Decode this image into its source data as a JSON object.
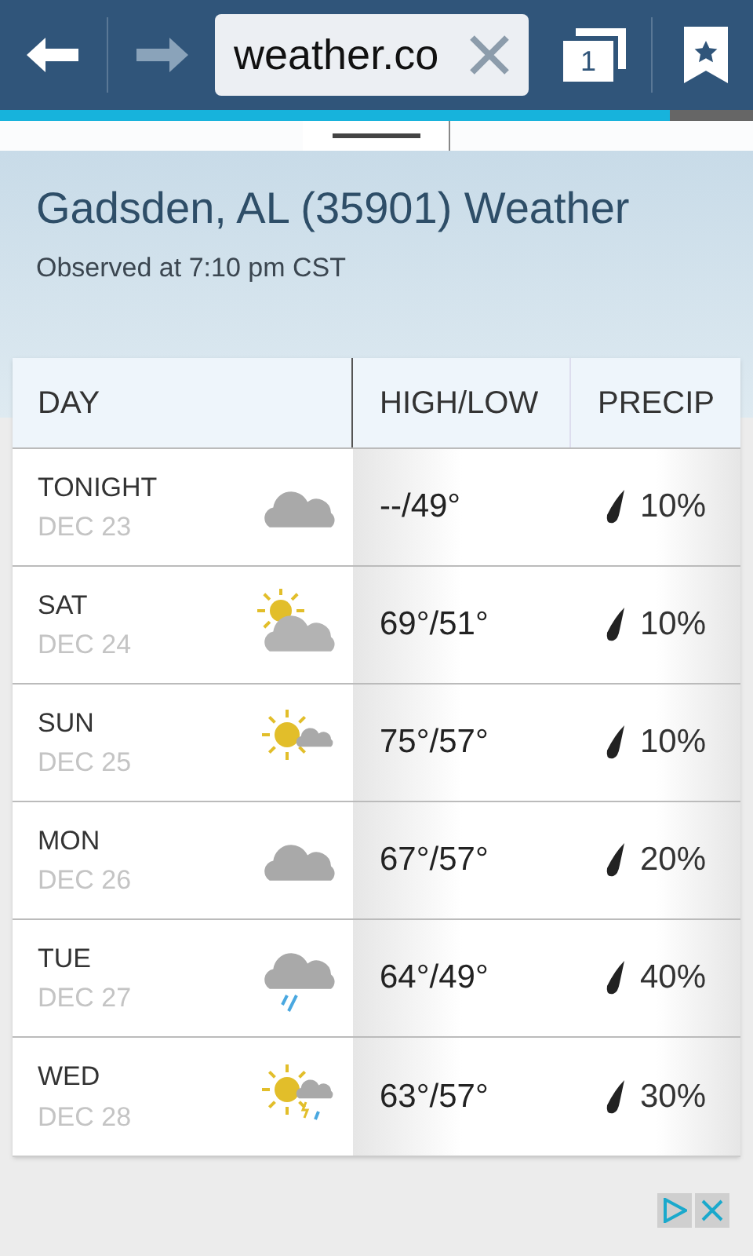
{
  "toolbar": {
    "url": "weather.co",
    "tab_count": "1",
    "load_progress": {
      "level": 0.89
    }
  },
  "header": {
    "title": "Gadsden, AL (35901) Weather",
    "observed": "Observed at 7:10 pm CST"
  },
  "table": {
    "columns": [
      "DAY",
      "HIGH/LOW",
      "PRECIP"
    ],
    "rows": [
      {
        "day": "TONIGHT",
        "date": "DEC 23",
        "kind": "cloudy",
        "high_low": "--/49°",
        "precip": "10%"
      },
      {
        "day": "SAT",
        "date": "DEC 24",
        "kind": "partly-cloudy",
        "high_low": "69°/51°",
        "precip": "10%"
      },
      {
        "day": "SUN",
        "date": "DEC 25",
        "kind": "mostly-sunny",
        "high_low": "75°/57°",
        "precip": "10%"
      },
      {
        "day": "MON",
        "date": "DEC 26",
        "kind": "cloudy",
        "high_low": "67°/57°",
        "precip": "20%"
      },
      {
        "day": "TUE",
        "date": "DEC 27",
        "kind": "rain",
        "high_low": "64°/49°",
        "precip": "40%"
      },
      {
        "day": "WED",
        "date": "DEC 28",
        "kind": "sun-storm",
        "high_low": "63°/57°",
        "precip": "30%"
      }
    ]
  }
}
